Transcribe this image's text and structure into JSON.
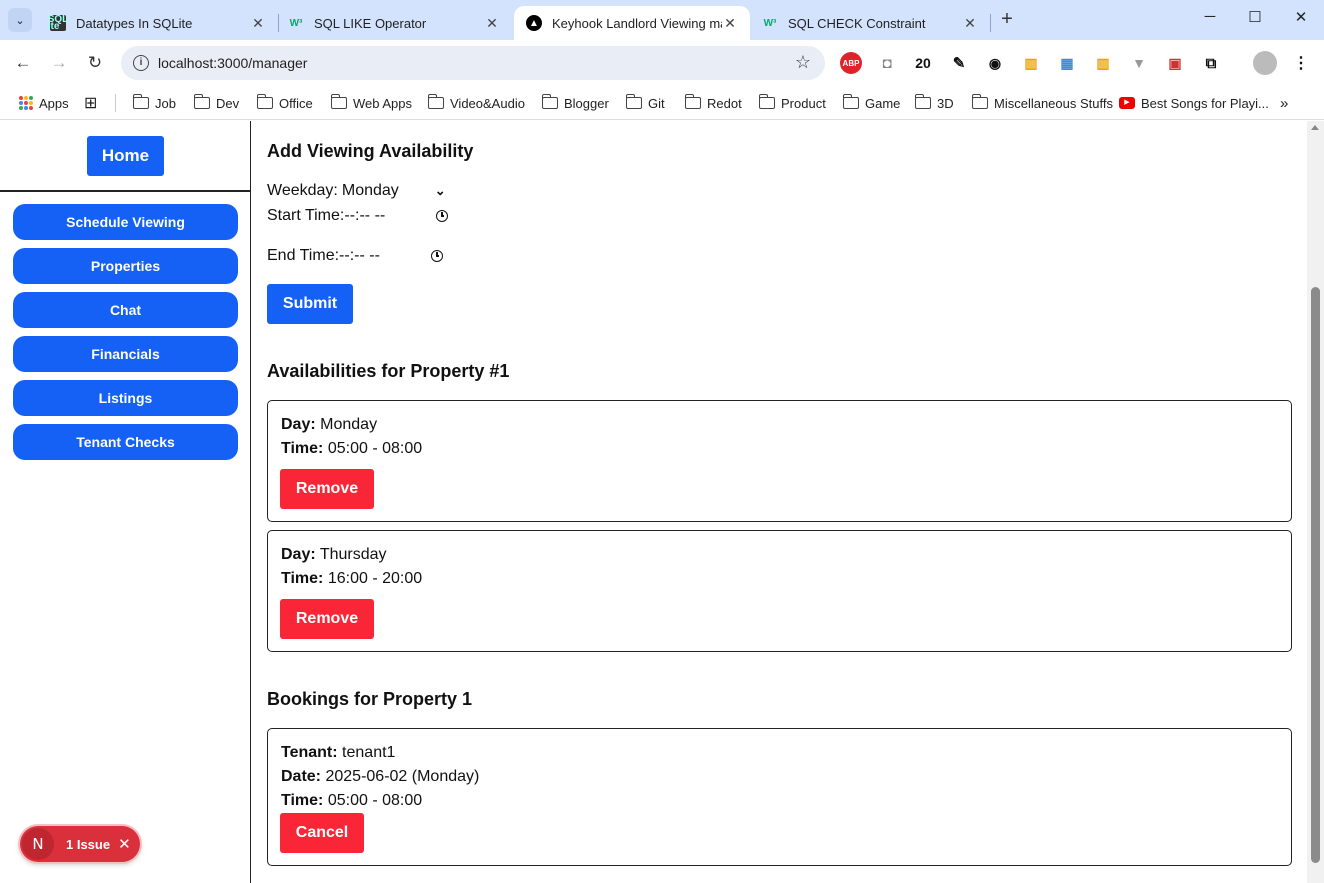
{
  "browser": {
    "tabs": [
      {
        "title": "Datatypes In SQLite",
        "icon": "sqlite-favicon"
      },
      {
        "title": "SQL LIKE Operator",
        "icon": "w3schools-favicon"
      },
      {
        "title": "Keyhook Landlord Viewing man",
        "icon": "keyhook-favicon"
      },
      {
        "title": "SQL CHECK Constraint",
        "icon": "w3schools-favicon"
      }
    ],
    "url": "localhost:3000/manager",
    "ext_badge": "20",
    "ext_abp": "ABP",
    "bookmarks": [
      "Apps",
      "Job",
      "Dev",
      "Office",
      "Web Apps",
      "Video&Audio",
      "Blogger",
      "Git",
      "Redot",
      "Product",
      "Game",
      "3D",
      "Miscellaneous Stuffs",
      "Best Songs for Playi..."
    ]
  },
  "sidebar": {
    "home": "Home",
    "items": [
      "Schedule Viewing",
      "Properties",
      "Chat",
      "Financials",
      "Listings",
      "Tenant Checks"
    ]
  },
  "availability_form": {
    "title": "Add Viewing Availability",
    "weekday_label": "Weekday:",
    "weekday_value": "Monday",
    "start_label": "Start Time:",
    "start_value": "--:-- --",
    "end_label": "End Time:",
    "end_value": "--:-- --",
    "submit": "Submit"
  },
  "availabilities": {
    "title": "Availabilities for Property #1",
    "day_label": "Day:",
    "time_label": "Time:",
    "remove_label": "Remove",
    "items": [
      {
        "day": "Monday",
        "time": "05:00 - 08:00"
      },
      {
        "day": "Thursday",
        "time": "16:00 - 20:00"
      }
    ]
  },
  "bookings": {
    "title": "Bookings for Property 1",
    "tenant_label": "Tenant:",
    "date_label": "Date:",
    "time_label": "Time:",
    "cancel_label": "Cancel",
    "items": [
      {
        "tenant": "tenant1",
        "date": "2025-06-02 (Monday)",
        "time": "05:00 - 08:00"
      }
    ]
  },
  "issue_badge": {
    "logo": "N",
    "text": "1 Issue"
  },
  "colors": {
    "primary": "#1560f5",
    "danger": "#fa2637",
    "tabstrip": "#d3e3fd"
  }
}
